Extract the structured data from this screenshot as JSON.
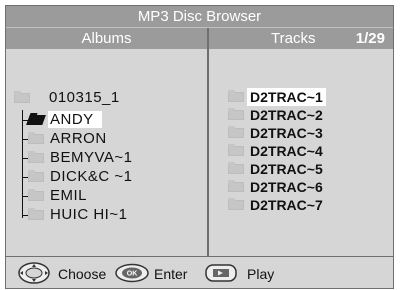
{
  "title": "MP3 Disc Browser",
  "albums_header": "Albums",
  "tracks_header": {
    "label": "Tracks",
    "count": "1/29"
  },
  "albums": {
    "root": "010315_1",
    "items": [
      "ANDY",
      "ARRON",
      "BEMYVA~1",
      "DICK&C ~1",
      "EMIL",
      "HUIC HI~1"
    ]
  },
  "tracks": [
    "D2TRAC~1",
    "D2TRAC~2",
    "D2TRAC~3",
    "D2TRAC~4",
    "D2TRAC~5",
    "D2TRAC~6",
    "D2TRAC~7"
  ],
  "footer": {
    "choose": "Choose",
    "enter": "Enter",
    "play": "Play",
    "ok_icon_text": "OK"
  },
  "colors": {
    "header_bg": "#9b9b9b",
    "panel_bg": "#d6d6d6",
    "selection_bg": "#ffffff"
  }
}
